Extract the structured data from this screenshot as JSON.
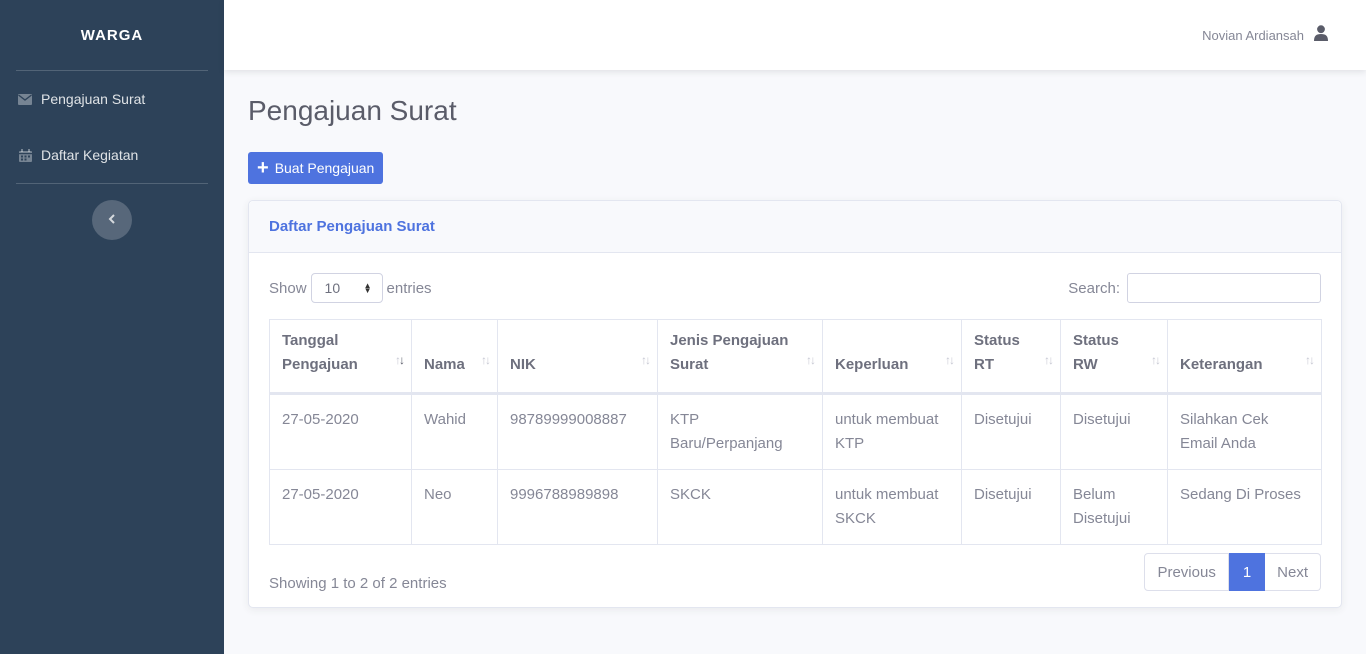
{
  "sidebar": {
    "brand": "WARGA",
    "items": [
      {
        "label": "Pengajuan Surat",
        "icon": "envelope-icon"
      },
      {
        "label": "Daftar Kegiatan",
        "icon": "calendar-icon"
      }
    ],
    "toggle_icon": "chevron-left-icon"
  },
  "topbar": {
    "user_name": "Novian Ardiansah",
    "user_icon": "user-icon"
  },
  "page": {
    "title": "Pengajuan Surat",
    "add_button": "Buat Pengajuan"
  },
  "card": {
    "title": "Daftar Pengajuan Surat",
    "show_label": "Show",
    "entries_label": "entries",
    "page_length": "10",
    "search_label": "Search:",
    "search_value": "",
    "columns": [
      {
        "line1": "Tanggal",
        "line2": "Pengajuan"
      },
      {
        "line1": "",
        "line2": "Nama"
      },
      {
        "line1": "",
        "line2": "NIK"
      },
      {
        "line1": "Jenis Pengajuan",
        "line2": "Surat"
      },
      {
        "line1": "",
        "line2": "Keperluan"
      },
      {
        "line1": "Status",
        "line2": "RT"
      },
      {
        "line1": "Status",
        "line2": "RW"
      },
      {
        "line1": "",
        "line2": "Keterangan"
      }
    ],
    "rows": [
      {
        "tanggal": "27-05-2020",
        "nama": "Wahid",
        "nik": "98789999008887",
        "jenis": "KTP Baru/Perpanjang",
        "keperluan": "untuk membuat KTP",
        "status_rt": "Disetujui",
        "status_rw": "Disetujui",
        "keterangan": "Silahkan Cek Email Anda"
      },
      {
        "tanggal": "27-05-2020",
        "nama": "Neo",
        "nik": "9996788989898",
        "jenis": "SKCK",
        "keperluan": "untuk membuat SKCK",
        "status_rt": "Disetujui",
        "status_rw": "Belum Disetujui",
        "keterangan": "Sedang Di Proses"
      }
    ],
    "info": "Showing 1 to 2 of 2 entries",
    "pagination": {
      "previous": "Previous",
      "current": "1",
      "next": "Next"
    }
  },
  "colors": {
    "sidebar": "#2d4259",
    "primary": "#4e73df",
    "text": "#858796"
  }
}
